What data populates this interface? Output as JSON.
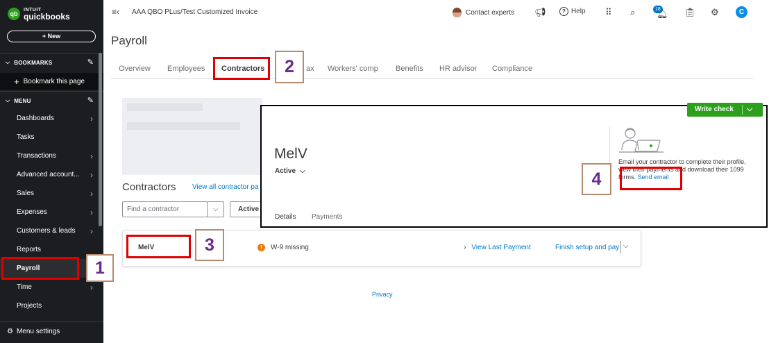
{
  "sidebar": {
    "logo_small": "INTUIT",
    "logo_big": "quickbooks",
    "logo_mark": "qb",
    "new_label": "+ New",
    "bookmarks_label": "BOOKMARKS",
    "bookmark_this_page": "Bookmark this page",
    "menu_label": "MENU",
    "items": [
      {
        "label": "Dashboards",
        "chevron": true
      },
      {
        "label": "Tasks",
        "chevron": false
      },
      {
        "label": "Transactions",
        "chevron": true
      },
      {
        "label": "Advanced account...",
        "chevron": true
      },
      {
        "label": "Sales",
        "chevron": true
      },
      {
        "label": "Expenses",
        "chevron": true
      },
      {
        "label": "Customers & leads",
        "chevron": true
      },
      {
        "label": "Reports",
        "chevron": false
      },
      {
        "label": "Payroll",
        "chevron": false
      },
      {
        "label": "Time",
        "chevron": true
      },
      {
        "label": "Projects",
        "chevron": false
      }
    ],
    "menu_settings": "Menu settings"
  },
  "topbar": {
    "company": "AAA QBO PLus/Test Customized Invoice",
    "contact_experts": "Contact experts",
    "help": "Help",
    "notification_count": "18",
    "user_initial": "C"
  },
  "main": {
    "title": "Payroll",
    "tabs": [
      "Overview",
      "Employees",
      "Contractors",
      "Tax",
      "Workers' comp",
      "Benefits",
      "HR advisor",
      "Compliance"
    ],
    "tab_visible_text": [
      "Overview",
      "Employees",
      "Contractors",
      "ax",
      "Workers' comp",
      "Benefits",
      "HR advisor",
      "Compliance"
    ],
    "contractors_heading": "Contractors",
    "view_all_link": "View all contractor pa",
    "find_placeholder": "Find a contractor",
    "active_filter": "Active",
    "row": {
      "name": "MelV",
      "warning": "W-9 missing",
      "view_last_payment": "View Last Payment",
      "finish_setup": "Finish setup and pay"
    },
    "privacy": "Privacy"
  },
  "inset": {
    "write_check": "Write check",
    "name": "MelV",
    "status": "Active",
    "email_text_1": "Email your contractor to complete their profile,",
    "email_text_2": "view their payments and download their 1099",
    "email_text_3": "forms.",
    "send_email": "Send email",
    "tabs": [
      "Details",
      "Payments"
    ]
  },
  "callouts": [
    "1",
    "2",
    "3",
    "4"
  ],
  "colors": {
    "sidebar_bg": "#1b1d20",
    "brand_green": "#2ca01c",
    "link_blue": "#0077c5",
    "callout_red": "#e00000",
    "callout_number": "#6a2b8f",
    "warning_orange": "#ec7a0d"
  }
}
